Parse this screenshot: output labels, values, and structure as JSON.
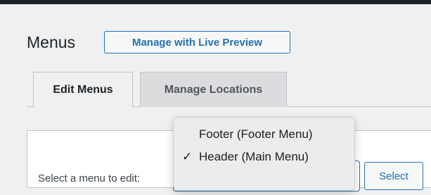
{
  "header": {
    "title": "Menus",
    "live_preview_label": "Manage with Live Preview"
  },
  "tabs": [
    {
      "label": "Edit Menus",
      "active": true
    },
    {
      "label": "Manage Locations",
      "active": false
    }
  ],
  "menu_select": {
    "label": "Select a menu to edit:",
    "selected": "Header (Main Menu)",
    "options": [
      {
        "label": "Footer (Footer Menu)",
        "selected": false
      },
      {
        "label": "Header (Main Menu)",
        "selected": true,
        "check": "✓"
      }
    ],
    "button_label": "Select"
  },
  "colors": {
    "accent": "#2271b1",
    "background": "#f0f0f1",
    "admin_bar": "#1d2327"
  }
}
